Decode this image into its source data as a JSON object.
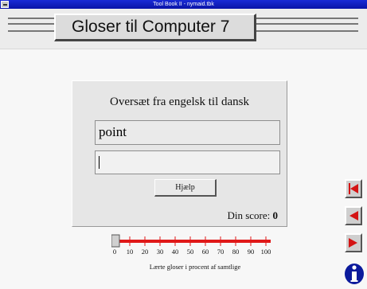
{
  "window": {
    "title": "Tool Book II - nymaid.tbk"
  },
  "header": {
    "title": "Gloser til Computer 7"
  },
  "quiz": {
    "instruction": "Oversæt fra engelsk til dansk",
    "word": "point",
    "answer_value": "",
    "help_label": "Hjælp",
    "score_label": "Din score:",
    "score_value": "0"
  },
  "progress": {
    "value_percent": 0,
    "ticks": [
      "0",
      "10",
      "20",
      "30",
      "40",
      "50",
      "60",
      "70",
      "80",
      "90",
      "100"
    ],
    "label": "Lærte gloser i procent af samtlige",
    "color": "#e01818"
  },
  "nav": {
    "first_icon": "first-page-icon",
    "prev_icon": "previous-page-icon",
    "next_icon": "next-page-icon",
    "info_icon": "info-icon",
    "arrow_color": "#d41414"
  }
}
